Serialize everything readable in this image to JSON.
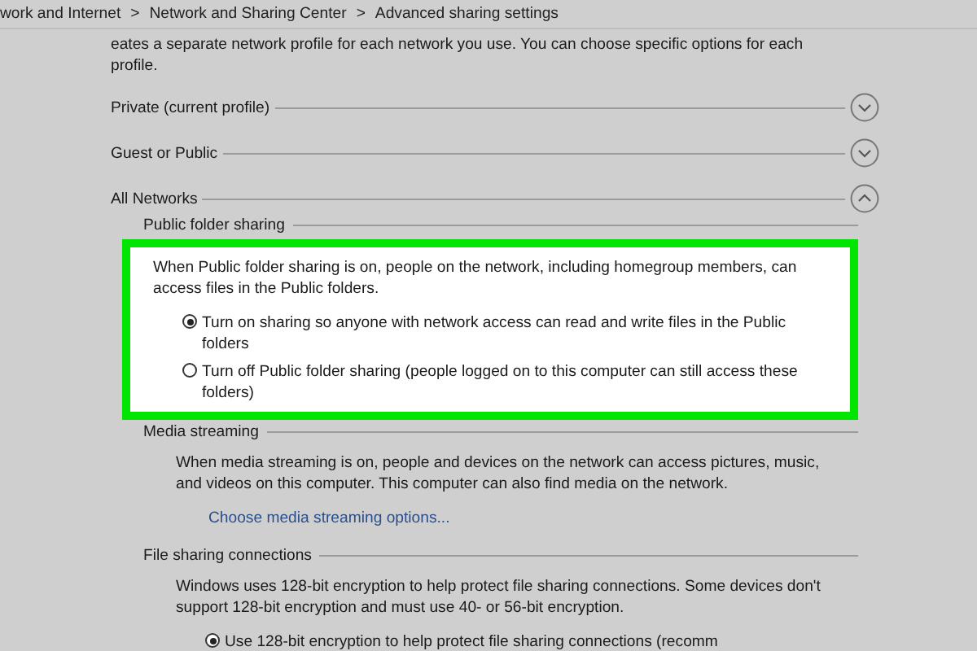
{
  "breadcrumb": {
    "items": [
      "work and Internet",
      "Network and Sharing Center",
      "Advanced sharing settings"
    ],
    "separator": ">"
  },
  "intro": "eates a separate network profile for each network you use. You can choose specific options for each profile.",
  "profiles": [
    {
      "name": "Private (current profile)",
      "expanded": false
    },
    {
      "name": "Guest or Public",
      "expanded": false
    },
    {
      "name": "All Networks",
      "expanded": true,
      "sections": [
        {
          "title": "Public folder sharing",
          "highlighted": true,
          "description": "When Public folder sharing is on, people on the network, including homegroup members, can access files in the Public folders.",
          "options": [
            {
              "label": "Turn on sharing so anyone with network access can read and write files in the Public folders",
              "selected": true
            },
            {
              "label": "Turn off Public folder sharing (people logged on to this computer can still access these folders)",
              "selected": false
            }
          ]
        },
        {
          "title": "Media streaming",
          "highlighted": false,
          "description": "When media streaming is on, people and devices on the network can access pictures, music, and videos on this computer. This computer can also find media on the network.",
          "link": "Choose media streaming options..."
        },
        {
          "title": "File sharing connections",
          "highlighted": false,
          "description": "Windows uses 128-bit encryption to help protect file sharing connections. Some devices don't support 128-bit encryption and must use 40- or 56-bit encryption.",
          "options": [
            {
              "label": "Use 128-bit encryption to help protect file sharing connections (recomm",
              "selected": true
            }
          ]
        }
      ]
    }
  ]
}
